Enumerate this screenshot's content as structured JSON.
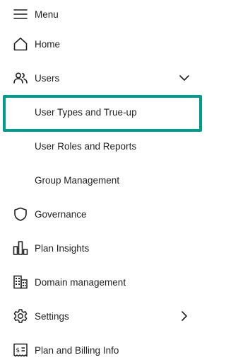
{
  "nav": {
    "menu_label": "Menu",
    "items": [
      {
        "label": "Home",
        "icon": "home-icon"
      },
      {
        "label": "Users",
        "icon": "users-icon",
        "expanded": true
      },
      {
        "label": "User Types and True-up",
        "selected": true
      },
      {
        "label": "User Roles and Reports"
      },
      {
        "label": "Group Management"
      },
      {
        "label": "Governance",
        "icon": "shield-icon"
      },
      {
        "label": "Plan Insights",
        "icon": "bar-chart-icon"
      },
      {
        "label": "Domain management",
        "icon": "building-icon"
      },
      {
        "label": "Settings",
        "icon": "gear-icon"
      },
      {
        "label": "Plan and Billing Info",
        "icon": "billing-icon"
      }
    ]
  },
  "colors": {
    "selected_outline": "#009b8a",
    "text": "#1f1f1f"
  }
}
